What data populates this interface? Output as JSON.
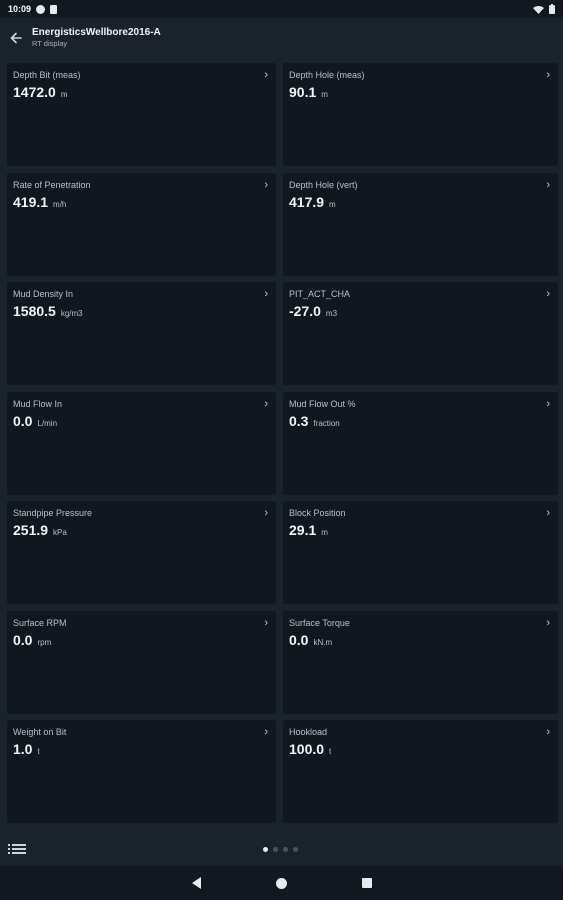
{
  "status_bar": {
    "time": "10:09",
    "battery_level": 1.0
  },
  "header": {
    "title": "EnergisticsWellbore2016-A",
    "subtitle": "RT display",
    "back_icon": "arrow-left-icon"
  },
  "cards": [
    {
      "label": "Depth Bit (meas)",
      "value": "1472.0",
      "unit": "m"
    },
    {
      "label": "Depth Hole (meas)",
      "value": "90.1",
      "unit": "m"
    },
    {
      "label": "Rate of Penetration",
      "value": "419.1",
      "unit": "m/h"
    },
    {
      "label": "Depth Hole (vert)",
      "value": "417.9",
      "unit": "m"
    },
    {
      "label": "Mud Density In",
      "value": "1580.5",
      "unit": "kg/m3"
    },
    {
      "label": "PIT_ACT_CHA",
      "value": "-27.0",
      "unit": "m3"
    },
    {
      "label": "Mud Flow In",
      "value": "0.0",
      "unit": "L/min"
    },
    {
      "label": "Mud Flow Out %",
      "value": "0.3",
      "unit": "fraction"
    },
    {
      "label": "Standpipe Pressure",
      "value": "251.9",
      "unit": "kPa"
    },
    {
      "label": "Block Position",
      "value": "29.1",
      "unit": "m"
    },
    {
      "label": "Surface RPM",
      "value": "0.0",
      "unit": "rpm"
    },
    {
      "label": "Surface Torque",
      "value": "0.0",
      "unit": "kN.m"
    },
    {
      "label": "Weight on Bit",
      "value": "1.0",
      "unit": "t"
    },
    {
      "label": "Hookload",
      "value": "100.0",
      "unit": "t"
    }
  ],
  "pager": {
    "pages": 4,
    "current": 1
  },
  "colors": {
    "background": "#1a222c",
    "card": "#10171f",
    "text_primary": "#f4f6f8",
    "text_secondary": "#b8c0c8"
  }
}
